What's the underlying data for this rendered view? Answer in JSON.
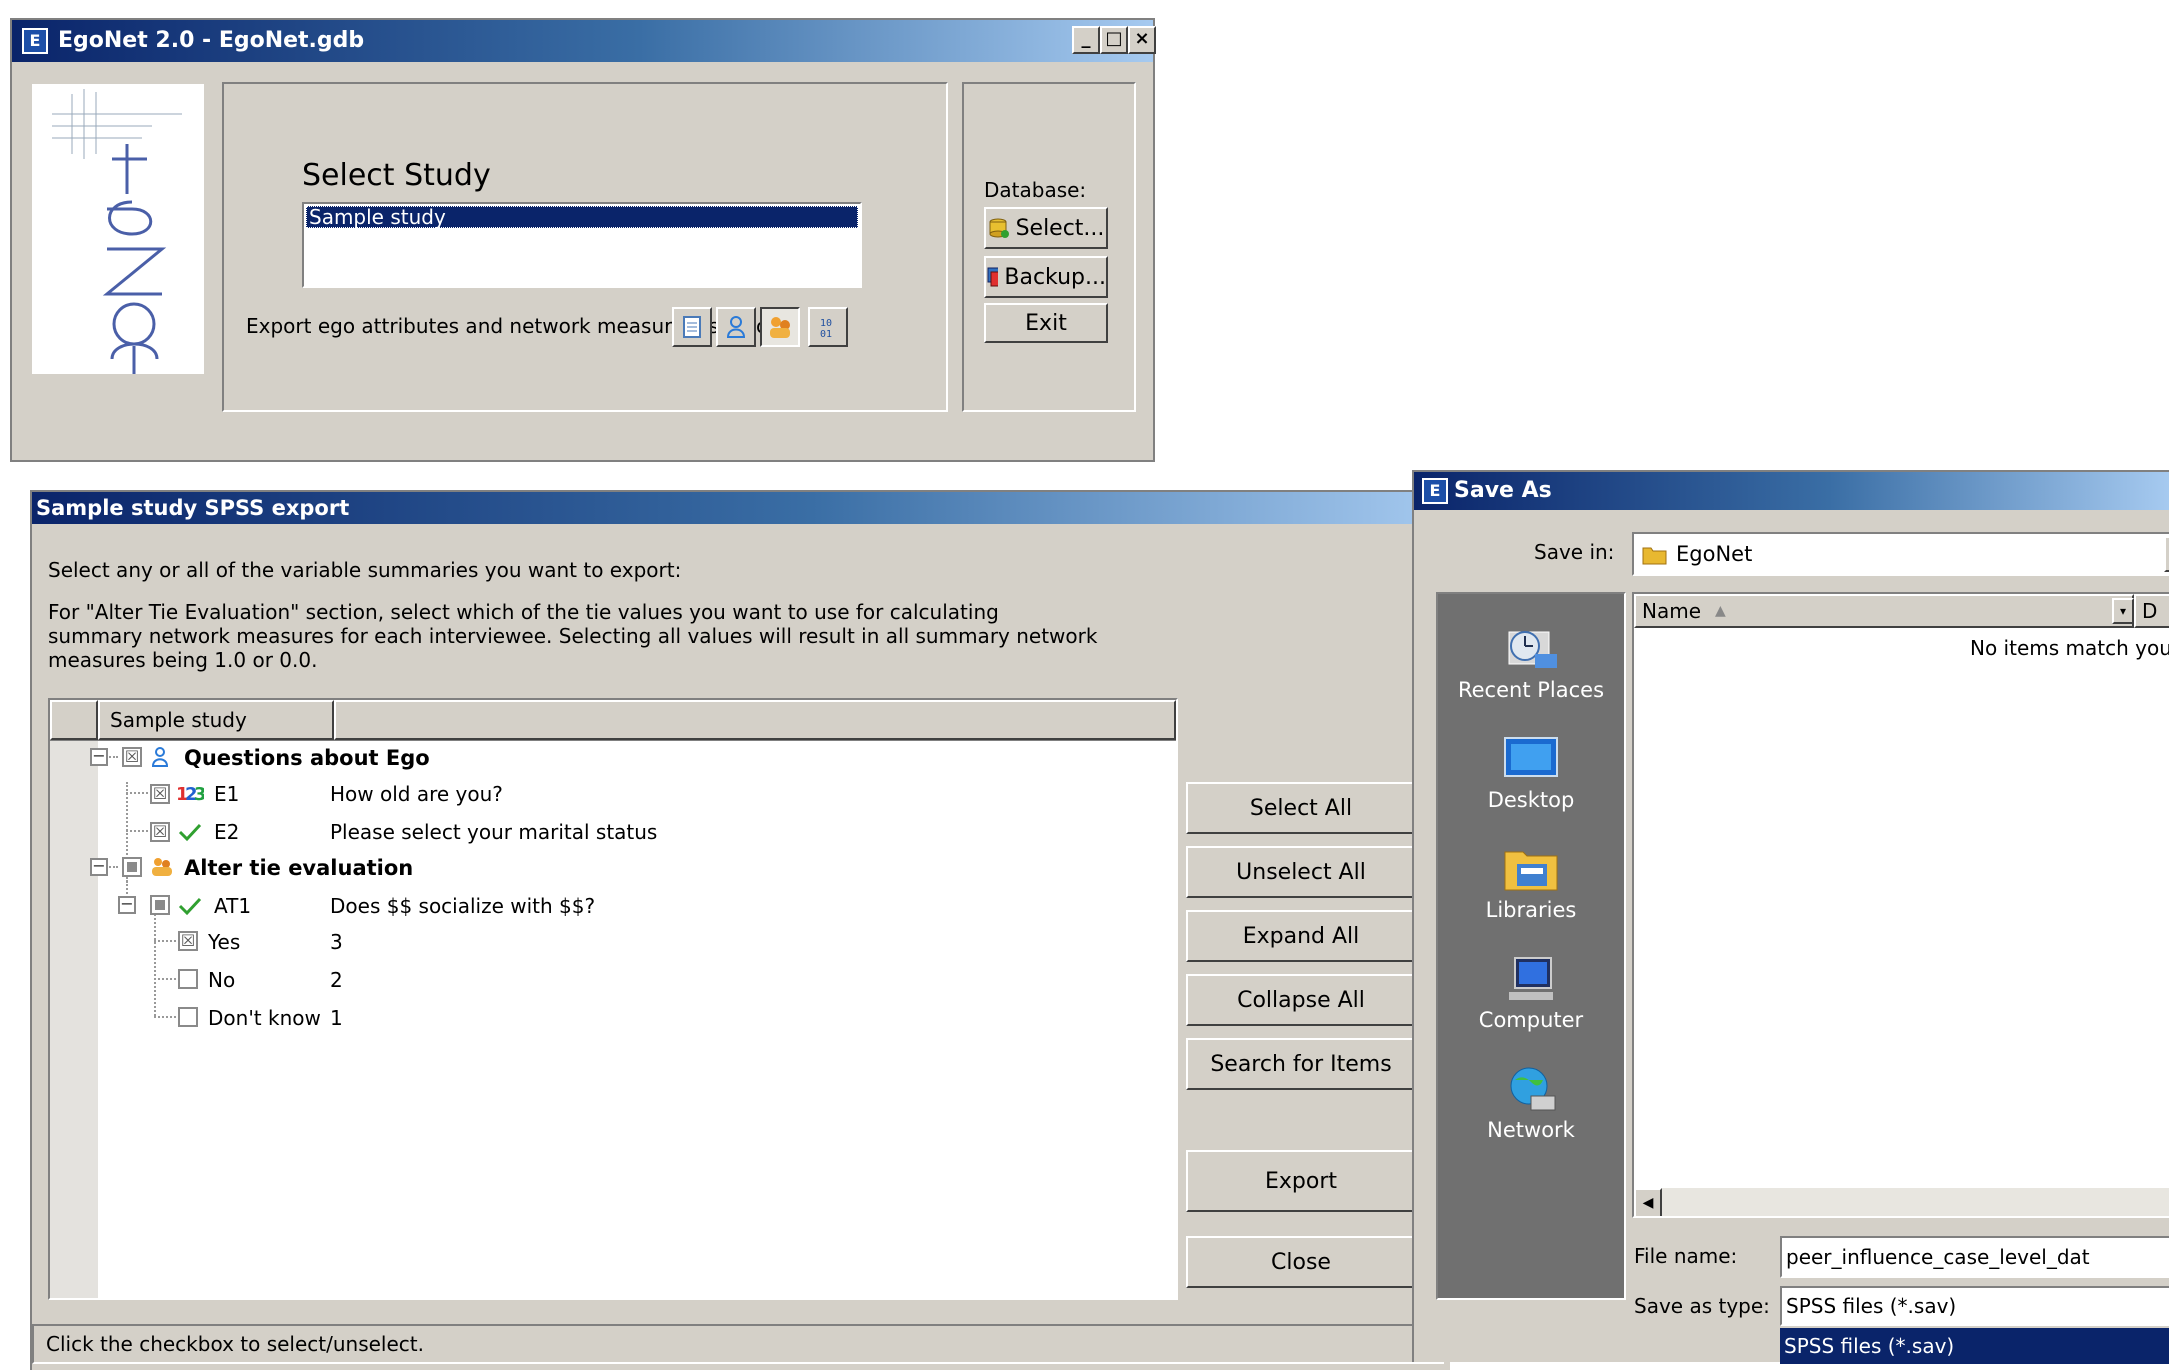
{
  "main_window": {
    "title": "EgoNet 2.0 - EgoNet.gdb",
    "select_study_heading": "Select Study",
    "studies": [
      "Sample study"
    ],
    "database_label": "Database:",
    "select_button": "Select...",
    "backup_button": "Backup...",
    "exit_button": "Exit",
    "export_label": "Export ego attributes and network measures (sav, csv)"
  },
  "spss_export": {
    "title": "Sample study SPSS export",
    "instruction1": "Select any or all of the variable summaries you want to export:",
    "instruction2_line1": "For \"Alter Tie Evaluation\" section, select which of the tie values you want to use for calculating",
    "instruction2_line2": "summary network measures for each interviewee. Selecting all values will result in all summary network",
    "instruction2_line3": "measures being 1.0 or 0.0.",
    "tree_header": "Sample study",
    "tree": [
      {
        "id": "",
        "label": "Questions about Ego",
        "value": "",
        "state": "checked"
      },
      {
        "id": "E1",
        "label": "",
        "value": "How old are you?",
        "state": "checked"
      },
      {
        "id": "E2",
        "label": "",
        "value": "Please select your marital status",
        "state": "checked"
      },
      {
        "id": "",
        "label": "Alter tie evaluation",
        "value": "",
        "state": "partial"
      },
      {
        "id": "AT1",
        "label": "",
        "value": "Does $$ socialize with $$?",
        "state": "partial"
      },
      {
        "id": "Yes",
        "label": "",
        "value": "3",
        "state": "checked"
      },
      {
        "id": "No",
        "label": "",
        "value": "2",
        "state": "unchecked"
      },
      {
        "id": "Don't know",
        "label": "",
        "value": "1",
        "state": "unchecked"
      }
    ],
    "buttons": {
      "select_all": "Select All",
      "unselect_all": "Unselect All",
      "expand_all": "Expand All",
      "collapse_all": "Collapse All",
      "search": "Search for Items",
      "export": "Export",
      "close": "Close"
    },
    "status": "Click the checkbox to select/unselect."
  },
  "save_as": {
    "title": "Save As",
    "save_in_label": "Save in:",
    "save_in_value": "EgoNet",
    "places": [
      "Recent Places",
      "Desktop",
      "Libraries",
      "Computer",
      "Network"
    ],
    "col_name": "Name",
    "col_d": "D",
    "empty_message": "No items match you",
    "file_name_label": "File name:",
    "file_name_value": "peer_influence_case_level_dat",
    "save_type_label": "Save as type:",
    "save_type_value": "SPSS files (*.sav)",
    "dropdown_option": "SPSS files (*.sav)"
  }
}
